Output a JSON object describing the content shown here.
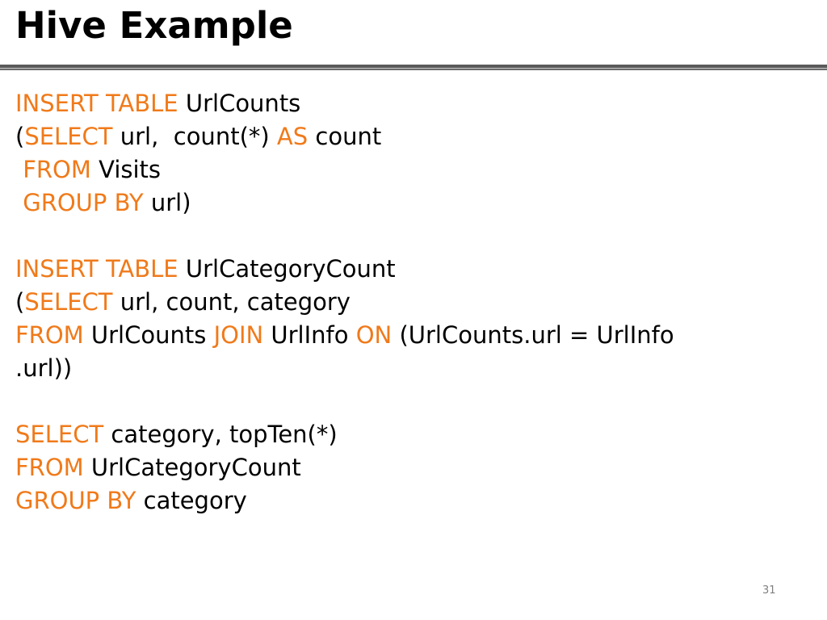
{
  "slide": {
    "title": "Hive Example",
    "page_number": "31",
    "keyword_color": "#f07a1a",
    "text_color": "#000000"
  },
  "code": {
    "lines": [
      [
        {
          "t": "INSERT TABLE",
          "kw": true
        },
        {
          "t": " UrlCounts",
          "kw": false
        }
      ],
      [
        {
          "t": "(",
          "kw": false
        },
        {
          "t": "SELECT",
          "kw": true
        },
        {
          "t": " url,  count(*) ",
          "kw": false
        },
        {
          "t": "AS",
          "kw": true
        },
        {
          "t": " count",
          "kw": false
        }
      ],
      [
        {
          "t": " ",
          "kw": false
        },
        {
          "t": "FROM",
          "kw": true
        },
        {
          "t": " Visits",
          "kw": false
        }
      ],
      [
        {
          "t": " ",
          "kw": false
        },
        {
          "t": "GROUP BY",
          "kw": true
        },
        {
          "t": " url)",
          "kw": false
        }
      ],
      [],
      [
        {
          "t": "INSERT TABLE",
          "kw": true
        },
        {
          "t": " UrlCategoryCount",
          "kw": false
        }
      ],
      [
        {
          "t": "(",
          "kw": false
        },
        {
          "t": "SELECT",
          "kw": true
        },
        {
          "t": " url, count, category",
          "kw": false
        }
      ],
      [
        {
          "t": "FROM",
          "kw": true
        },
        {
          "t": " UrlCounts ",
          "kw": false
        },
        {
          "t": "JOIN",
          "kw": true
        },
        {
          "t": " UrlInfo ",
          "kw": false
        },
        {
          "t": "ON",
          "kw": true
        },
        {
          "t": " (UrlCounts.url = UrlInfo",
          "kw": false
        }
      ],
      [
        {
          "t": ".url))",
          "kw": false
        }
      ],
      [],
      [
        {
          "t": "SELECT",
          "kw": true
        },
        {
          "t": " category, topTen(*)",
          "kw": false
        }
      ],
      [
        {
          "t": "FROM",
          "kw": true
        },
        {
          "t": " UrlCategoryCount",
          "kw": false
        }
      ],
      [
        {
          "t": "GROUP BY",
          "kw": true
        },
        {
          "t": " category",
          "kw": false
        }
      ]
    ]
  }
}
